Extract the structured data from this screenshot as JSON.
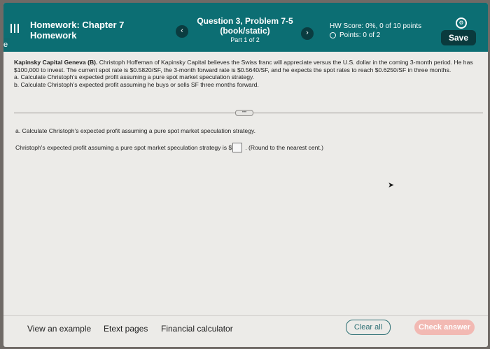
{
  "header": {
    "hw_title_bold": "Homework:",
    "hw_title_rest": "Chapter 7",
    "hw_subtitle": "Homework",
    "question_title": "Question 3, Problem 7-5",
    "question_subtitle": "(book/static)",
    "part": "Part 1 of 2",
    "score": "HW Score: 0%, 0 of 10 points",
    "points": "Points: 0 of 2",
    "save_label": "Save"
  },
  "problem": {
    "lead": "Kapinsky Capital Geneva (B).",
    "text": "Christoph Hoffeman of Kapinsky Capital believes the Swiss franc will appreciate versus the U.S. dollar in the coming 3-month period. He has $100,000 to invest. The current spot rate is $0.5820/SF, the 3-month forward rate is $0.5640/SF, and he expects the spot rates to reach $0.6250/SF in three months.",
    "item_a": "a. Calculate Christoph's expected profit assuming a pure spot market speculation strategy.",
    "item_b": "b. Calculate Christoph's expected profit assuming he buys or sells SF three months forward."
  },
  "work": {
    "question_a": "a. Calculate Christoph's expected profit assuming a pure spot market speculation strategy.",
    "answer_prompt": "Christoph's expected profit assuming a pure spot market speculation strategy is $",
    "answer_hint": ". (Round to the nearest cent.)"
  },
  "footer": {
    "example": "View an example",
    "etext": "Etext pages",
    "calculator": "Financial calculator",
    "clear": "Clear all",
    "check": "Check answer"
  },
  "colors": {
    "header": "#0c6e73",
    "save": "#0a3a3d",
    "check": "#f2b9b3",
    "clear_border": "#2b6e73"
  }
}
